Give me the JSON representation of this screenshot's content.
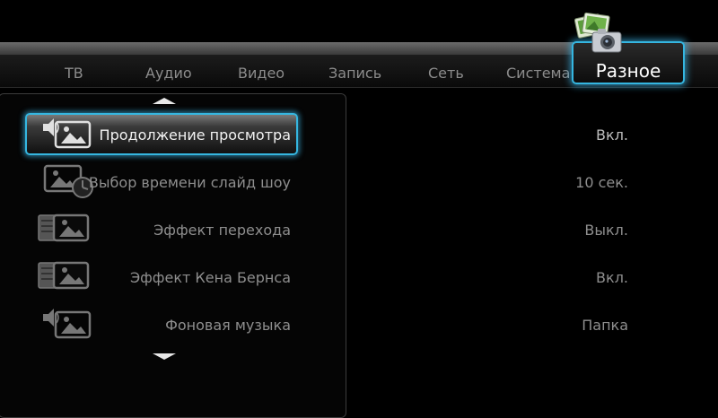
{
  "tabs": [
    {
      "label": "ТВ"
    },
    {
      "label": "Аудио"
    },
    {
      "label": "Видео"
    },
    {
      "label": "Запись"
    },
    {
      "label": "Сеть"
    },
    {
      "label": "Система"
    },
    {
      "label": "Разное",
      "active": true
    }
  ],
  "tab_icon": "photo-camera-icon",
  "settings": [
    {
      "label": "Продолжение просмотра",
      "value": "Вкл.",
      "icon": "photo-speaker-icon",
      "selected": true
    },
    {
      "label": "Выбор времени слайд шоу",
      "value": "10 сек.",
      "icon": "photo-clock-icon"
    },
    {
      "label": "Эффект перехода",
      "value": "Выкл.",
      "icon": "photo-transition-icon"
    },
    {
      "label": "Эффект Кена Бернса",
      "value": "Вкл.",
      "icon": "photo-transition-icon"
    },
    {
      "label": "Фоновая музыка",
      "value": "Папка",
      "icon": "photo-speaker-icon"
    }
  ],
  "colors": {
    "accent": "#35b6e0",
    "background": "#000000",
    "text_dim": "#8e8e8e",
    "text_active": "#f2f2f2"
  }
}
